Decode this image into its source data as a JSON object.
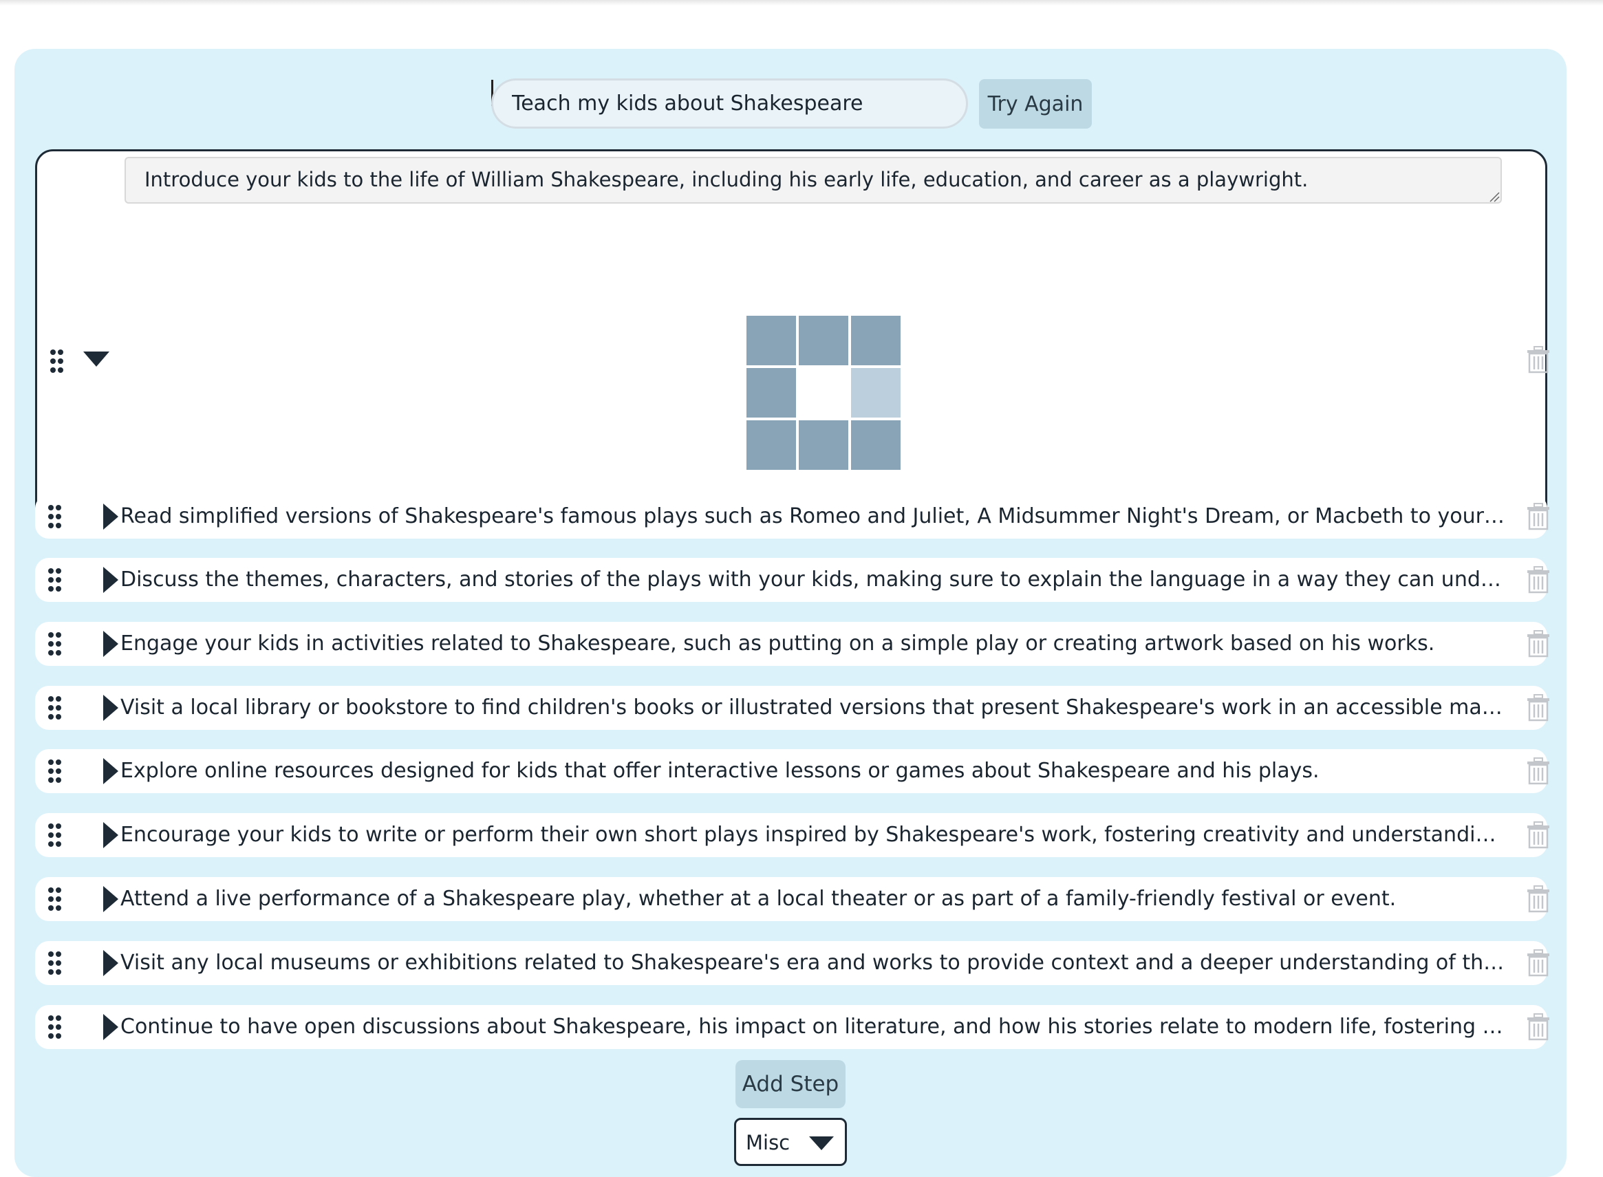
{
  "goal": {
    "value": "Teach my kids about Shakespeare",
    "try_again_label": "Try Again"
  },
  "expanded_step": {
    "text": "Introduce your kids to the life of William Shakespeare, including his early life, education, and career as a playwright."
  },
  "steps": [
    "Read simplified versions of Shakespeare's famous plays such as Romeo and Juliet, A Midsummer Night's Dream, or Macbeth to your kids, ...",
    "Discuss the themes, characters, and stories of the plays with your kids, making sure to explain the language in a way they can understand.",
    "Engage your kids in activities related to Shakespeare, such as putting on a simple play or creating artwork based on his works.",
    "Visit a local library or bookstore to find children's books or illustrated versions that present Shakespeare's work in an accessible manner.",
    "Explore online resources designed for kids that offer interactive lessons or games about Shakespeare and his plays.",
    "Encourage your kids to write or perform their own short plays inspired by Shakespeare's work, fostering creativity and understanding of dr...",
    "Attend a live performance of a Shakespeare play, whether at a local theater or as part of a family-friendly festival or event.",
    "Visit any local museums or exhibitions related to Shakespeare's era and works to provide context and a deeper understanding of the play...",
    "Continue to have open discussions about Shakespeare, his impact on literature, and how his stories relate to modern life, fostering a lifelo..."
  ],
  "add_step_label": "Add Step",
  "category": {
    "selected": "Misc"
  },
  "colors": {
    "panel": "#dcf2fb",
    "button": "#bddae4",
    "dark": "#1e2b36",
    "loader": "#8aa4b7",
    "loader_light": "#bccfdc"
  },
  "icons": [
    "drag-handle-icon",
    "caret-down-icon",
    "caret-right-icon",
    "trash-icon",
    "loading-grid-icon",
    "chevron-down-icon"
  ]
}
